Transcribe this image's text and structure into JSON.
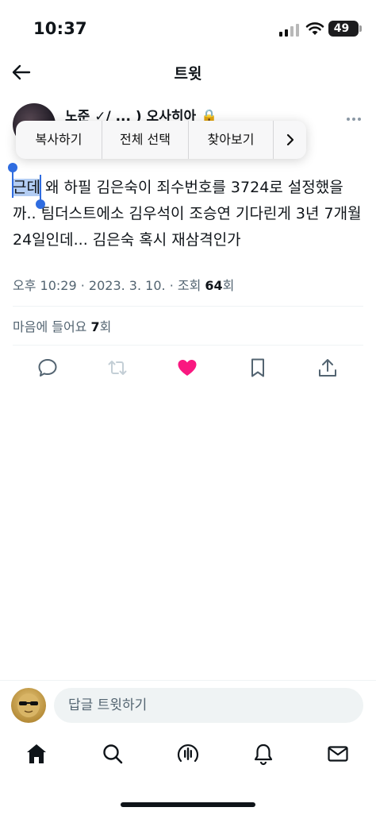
{
  "status_bar": {
    "time": "10:37",
    "battery": "49"
  },
  "header": {
    "title": "트윗"
  },
  "tweet": {
    "author_line": "노준 ✓/ ... ) 오사히아 🔒",
    "text_selected": "근데",
    "text_rest": " 왜 하필 김은숙이 죄수번호를 3724로 설정했을까.. 팀더스트에소 김우석이 조승연 기다린게 3년 7개월 24일인데... 김은숙 혹시 재삼격인가",
    "meta": {
      "time": "오후 10:29",
      "date": "2023. 3. 10.",
      "views_label": "조회",
      "views": "64",
      "views_suffix": "회"
    },
    "likes": {
      "label": "마음에 들어요",
      "count": "7",
      "suffix": "회"
    }
  },
  "context_menu": {
    "items": [
      "복사하기",
      "전체 선택",
      "찾아보기"
    ]
  },
  "reply": {
    "placeholder": "답글 트윗하기"
  },
  "colors": {
    "like": "#f91880",
    "selection": "#b3cdf3",
    "handle": "#2f6ce0"
  },
  "icons": {
    "actions": [
      "reply-icon",
      "retweet-icon",
      "like-icon",
      "bookmark-icon",
      "share-icon"
    ],
    "tabs": [
      "home-icon",
      "search-icon",
      "spaces-icon",
      "notifications-icon",
      "messages-icon"
    ]
  }
}
